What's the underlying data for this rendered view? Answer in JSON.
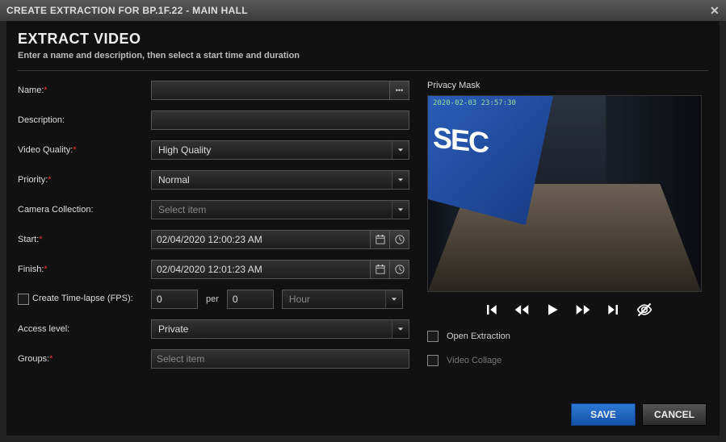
{
  "title": "CREATE EXTRACTION FOR BP.1F.22 - MAIN HALL",
  "header": {
    "heading": "EXTRACT VIDEO",
    "sub": "Enter a name and description, then select a start time and duration"
  },
  "labels": {
    "name": "Name:",
    "description": "Description:",
    "videoQuality": "Video Quality:",
    "priority": "Priority:",
    "cameraCollection": "Camera Collection:",
    "start": "Start:",
    "finish": "Finish:",
    "timelapse": "Create Time-lapse (FPS):",
    "per": "per",
    "accessLevel": "Access level:",
    "groups": "Groups:",
    "privacyMask": "Privacy Mask",
    "openExtraction": "Open Extraction",
    "videoCollage": "Video Collage"
  },
  "values": {
    "name": "",
    "description": "",
    "videoQuality": "High Quality",
    "priority": "Normal",
    "cameraCollection": "Select item",
    "start": "02/04/2020 12:00:23 AM",
    "finish": "02/04/2020 12:01:23 AM",
    "tlFrames": "0",
    "tlPer": "0",
    "tlUnit": "Hour",
    "accessLevel": "Private",
    "groups": "Select item"
  },
  "preview": {
    "timestamp": "2020-02-03 23:57:30",
    "bannerText": "SEC"
  },
  "buttons": {
    "save": "SAVE",
    "cancel": "CANCEL"
  }
}
